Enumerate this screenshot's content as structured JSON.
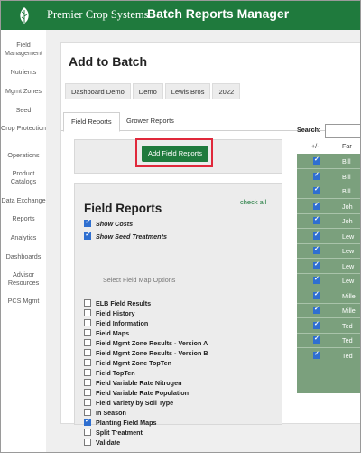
{
  "header": {
    "brand": "Premier Crop Systems",
    "app_title": "Batch Reports Manager",
    "logo_icon": "leaf-logo-icon"
  },
  "sidebar": {
    "items": [
      {
        "label": "Field Management"
      },
      {
        "label": "Nutrients"
      },
      {
        "label": "Mgmt Zones"
      },
      {
        "label": "Seed"
      },
      {
        "label": "Crop Protection"
      },
      {
        "label": "Operations"
      },
      {
        "label": "Product Catalogs"
      },
      {
        "label": "Data Exchange"
      },
      {
        "label": "Reports"
      },
      {
        "label": "Analytics"
      },
      {
        "label": "Dashboards"
      },
      {
        "label": "Advisor Resources"
      },
      {
        "label": "PCS Mgmt"
      }
    ]
  },
  "main": {
    "title": "Add to Batch",
    "breadcrumbs": [
      "Dashboard Demo",
      "Demo",
      "Lewis Bros",
      "2022"
    ],
    "tabs": [
      {
        "label": "Field Reports",
        "active": true
      },
      {
        "label": "Grower Reports",
        "active": false
      }
    ],
    "add_button": "Add Field Reports",
    "field_reports": {
      "title": "Field Reports",
      "check_all": "check all",
      "options": [
        {
          "label": "Show Costs",
          "checked": true
        },
        {
          "label": "Show Seed Treatments",
          "checked": true
        }
      ],
      "map_options": "Select Field Map Options",
      "reports": [
        {
          "label": "ELB Field Results",
          "checked": false
        },
        {
          "label": "Field History",
          "checked": false
        },
        {
          "label": "Field Information",
          "checked": false
        },
        {
          "label": "Field Maps",
          "checked": false
        },
        {
          "label": "Field Mgmt Zone Results - Version A",
          "checked": false
        },
        {
          "label": "Field Mgmt Zone Results - Version B",
          "checked": false
        },
        {
          "label": "Field Mgmt Zone TopTen",
          "checked": false
        },
        {
          "label": "Field TopTen",
          "checked": false
        },
        {
          "label": "Field Variable Rate Nitrogen",
          "checked": false
        },
        {
          "label": "Field Variable Rate Population",
          "checked": false
        },
        {
          "label": "Field Variety by Soil Type",
          "checked": false
        },
        {
          "label": "In Season",
          "checked": false
        },
        {
          "label": "Planting Field Maps",
          "checked": true
        },
        {
          "label": "Split Treatment",
          "checked": false
        },
        {
          "label": "Validate",
          "checked": false
        }
      ]
    },
    "table": {
      "search_label": "Search:",
      "search_value": "",
      "columns": [
        "+/-",
        "Far"
      ],
      "rows": [
        "Bill",
        "Bill",
        "Bill",
        "Joh",
        "Joh",
        "Lew",
        "Lew",
        "Lew",
        "Lew",
        "Mille",
        "Mille",
        "Ted",
        "Ted",
        "Ted"
      ]
    }
  },
  "colors": {
    "header_green": "#1f7a3d",
    "table_green": "#7ba07d",
    "highlight_red": "#e0283b"
  }
}
